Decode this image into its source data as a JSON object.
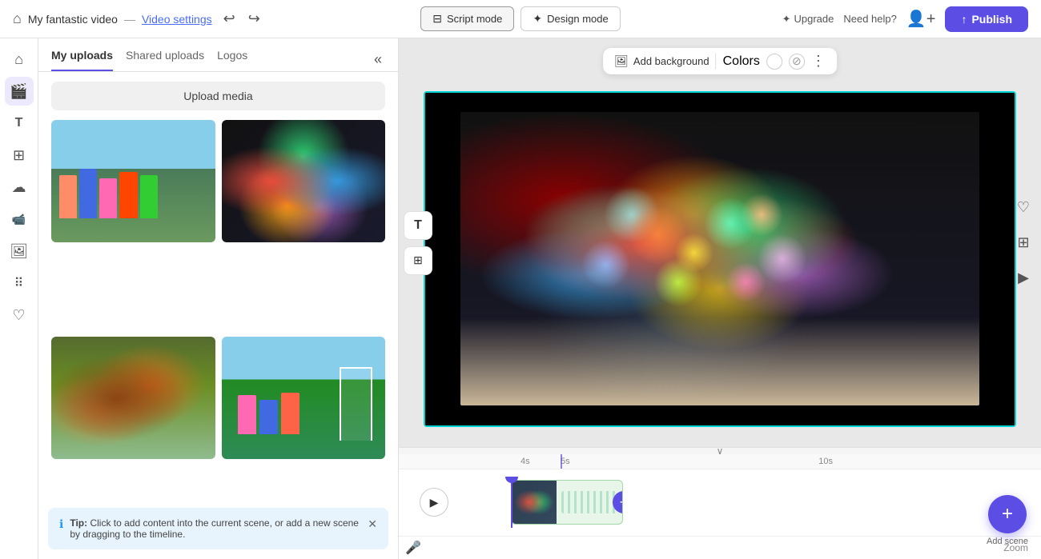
{
  "topbar": {
    "title": "My fantastic video",
    "separator": "—",
    "video_settings_label": "Video settings",
    "script_mode_label": "Script mode",
    "design_mode_label": "Design mode",
    "upgrade_label": "Upgrade",
    "need_help_label": "Need help?",
    "publish_label": "Publish"
  },
  "media_panel": {
    "tabs": [
      {
        "id": "my-uploads",
        "label": "My uploads"
      },
      {
        "id": "shared-uploads",
        "label": "Shared uploads"
      },
      {
        "id": "logos",
        "label": "Logos"
      }
    ],
    "upload_button_label": "Upload media",
    "thumbnails": [
      {
        "id": 1,
        "alt": "Children playing outdoors"
      },
      {
        "id": 2,
        "alt": "Colorful painted hands"
      },
      {
        "id": 3,
        "alt": "Child in autumn leaves"
      },
      {
        "id": 4,
        "alt": "Children playing soccer"
      }
    ]
  },
  "tip": {
    "prefix": "Tip:",
    "text": " Click to add content into the current scene, or add a new scene by dragging to the timeline."
  },
  "canvas_toolbar": {
    "add_background_label": "Add background",
    "colors_label": "Colors"
  },
  "timeline": {
    "ruler_marks": [
      "4s",
      "5s",
      "10s"
    ],
    "zoom_label": "Zoom",
    "add_scene_label": "Add scene"
  },
  "icons": {
    "home": "⌂",
    "film": "🎬",
    "text": "T",
    "layers": "⊞",
    "upload_cloud": "☁",
    "video_cam": "▶",
    "image": "🖼",
    "apps": "⠿",
    "heart": "♡",
    "undo": "↩",
    "redo": "↪",
    "collapse": "«",
    "chevron_down": "∨",
    "more_vert": "⋮",
    "strikethrough": "⊘",
    "close": "✕",
    "play": "▶",
    "mic": "🎤",
    "plus": "+",
    "chevron_left": "‹",
    "heart_outline": "♡",
    "grid": "⊞",
    "play_right": "▶",
    "info": "ℹ"
  },
  "colors": {
    "accent": "#5c4ee5",
    "teal_border": "#00d4d4",
    "white": "#ffffff"
  }
}
